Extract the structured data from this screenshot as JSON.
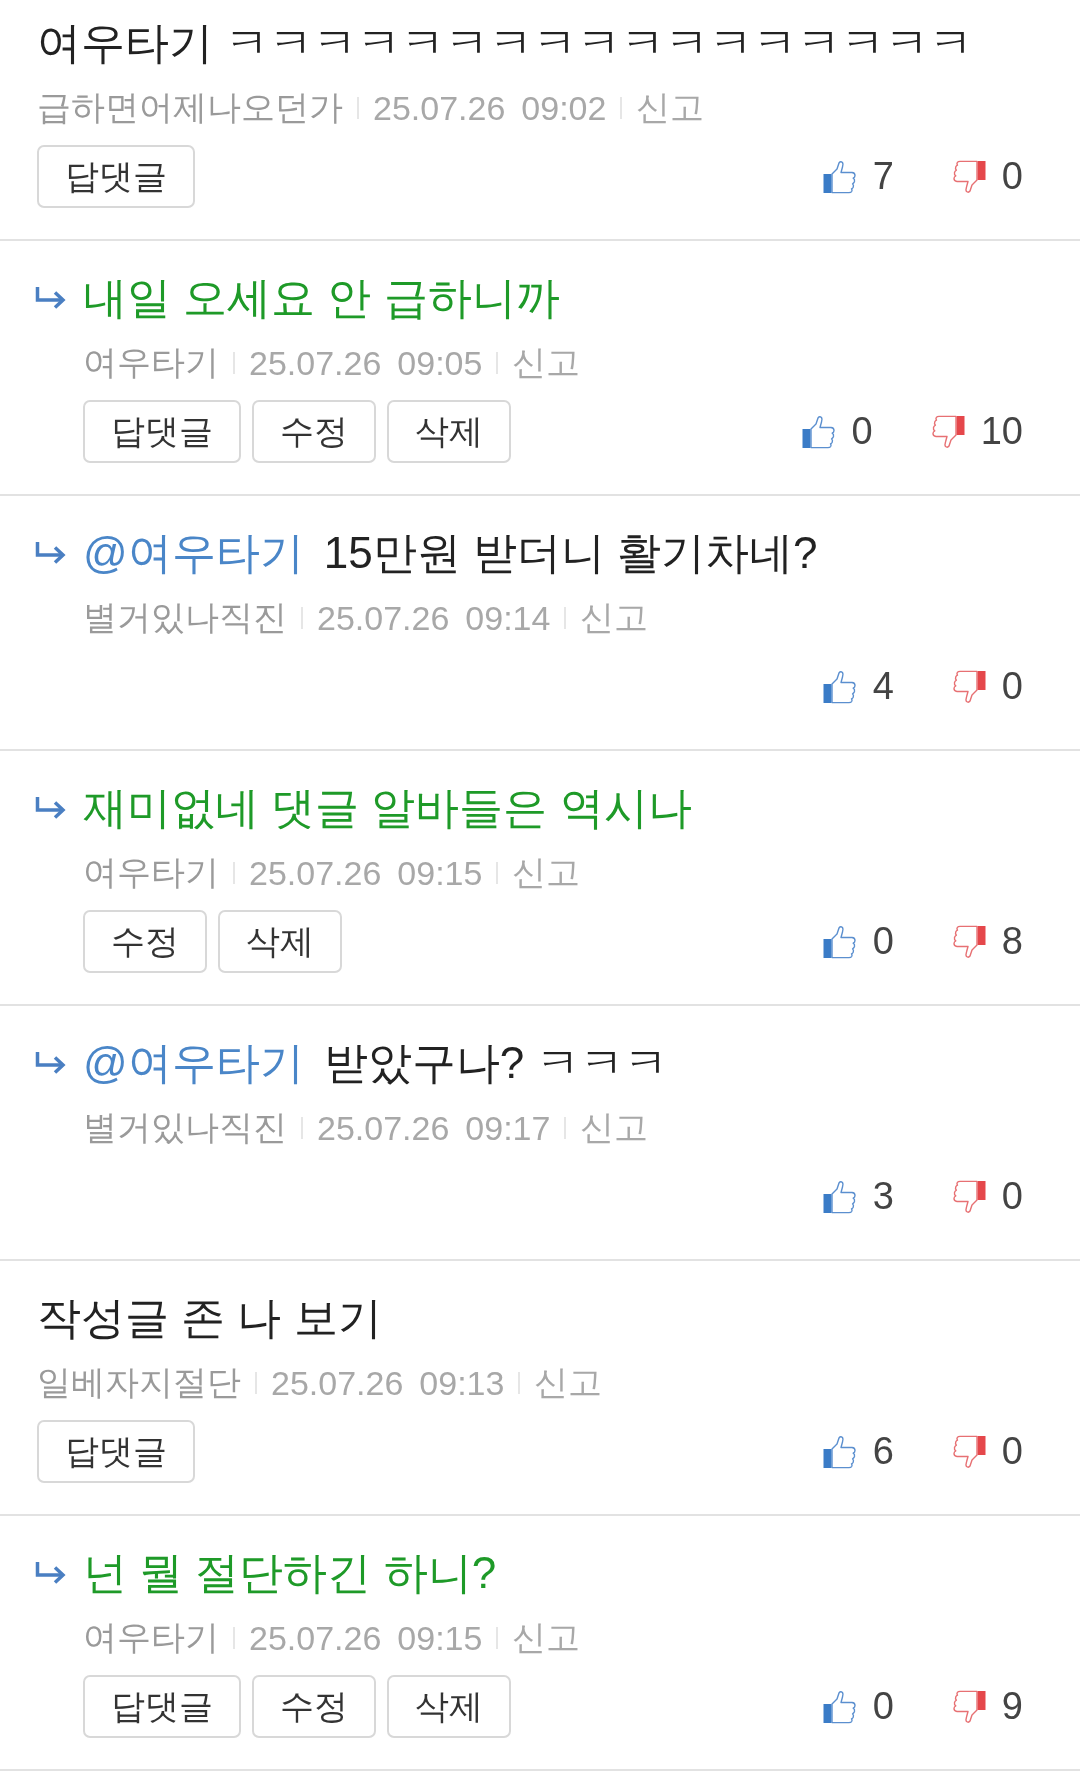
{
  "comments": [
    {
      "kind": "comment",
      "mine": false,
      "text": "여우타기 ㅋㅋㅋㅋㅋㅋㅋㅋㅋㅋㅋㅋㅋㅋㅋㅋㅋ",
      "author": "급하면어제나오던가",
      "date": "25.07.26",
      "time": "09:02",
      "report": "신고",
      "buttons": [
        "답댓글"
      ],
      "likes": "7",
      "dislikes": "0"
    },
    {
      "kind": "reply",
      "mine": true,
      "text": "내일 오세요 안 급하니까",
      "author": "여우타기",
      "date": "25.07.26",
      "time": "09:05",
      "report": "신고",
      "buttons": [
        "답댓글",
        "수정",
        "삭제"
      ],
      "likes": "0",
      "dislikes": "10"
    },
    {
      "kind": "reply",
      "mine": false,
      "mention": "@여우타기",
      "text": "15만원 받더니 활기차네?",
      "author": "별거있나직진",
      "date": "25.07.26",
      "time": "09:14",
      "report": "신고",
      "likes": "4",
      "dislikes": "0"
    },
    {
      "kind": "reply",
      "mine": true,
      "text": "재미없네 댓글 알바들은 역시나",
      "author": "여우타기",
      "date": "25.07.26",
      "time": "09:15",
      "report": "신고",
      "buttons": [
        "수정",
        "삭제"
      ],
      "likes": "0",
      "dislikes": "8"
    },
    {
      "kind": "reply",
      "mine": false,
      "mention": "@여우타기",
      "text": "받았구나? ㅋㅋㅋ",
      "author": "별거있나직진",
      "date": "25.07.26",
      "time": "09:17",
      "report": "신고",
      "likes": "3",
      "dislikes": "0"
    },
    {
      "kind": "comment",
      "mine": false,
      "text": "작성글 존 나 보기",
      "author": "일베자지절단",
      "date": "25.07.26",
      "time": "09:13",
      "report": "신고",
      "buttons": [
        "답댓글"
      ],
      "likes": "6",
      "dislikes": "0"
    },
    {
      "kind": "reply",
      "mine": true,
      "text": "넌 뭘 절단하긴 하니?",
      "author": "여우타기",
      "date": "25.07.26",
      "time": "09:15",
      "report": "신고",
      "buttons": [
        "답댓글",
        "수정",
        "삭제"
      ],
      "likes": "0",
      "dislikes": "9"
    }
  ]
}
